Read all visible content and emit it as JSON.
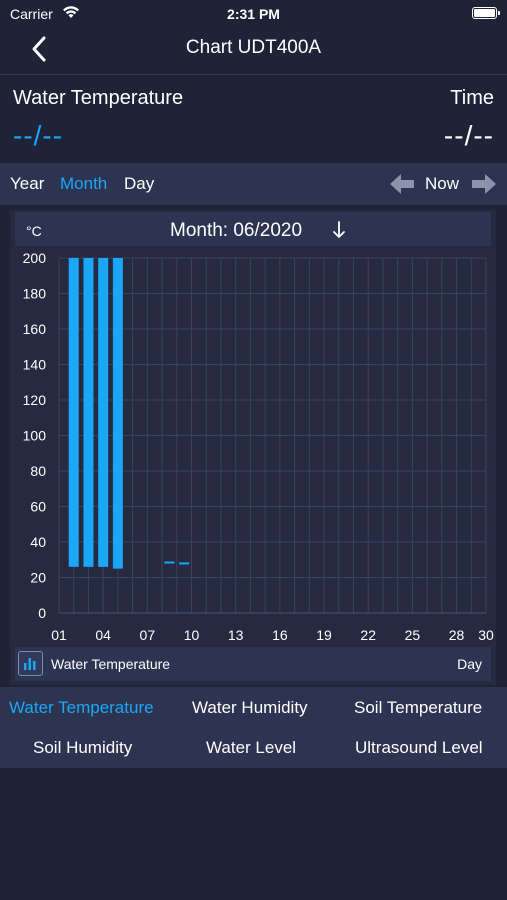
{
  "status_bar": {
    "carrier": "Carrier",
    "time": "2:31 PM",
    "wifi_icon": "wifi-icon",
    "battery_icon": "battery-icon"
  },
  "nav": {
    "title": "Chart UDT400A",
    "back_icon": "chevron-left-icon"
  },
  "readout": {
    "left_label": "Water Temperature",
    "left_value": "--/--",
    "right_label": "Time",
    "right_value": "--/--"
  },
  "period": {
    "tabs": [
      {
        "label": "Year",
        "active": false
      },
      {
        "label": "Month",
        "active": true
      },
      {
        "label": "Day",
        "active": false
      }
    ],
    "now_label": "Now"
  },
  "chart_header": {
    "unit": "°C",
    "month": "Month: 06/2020"
  },
  "chart_data": {
    "type": "bar",
    "ylim": [
      0,
      200
    ],
    "yticks": [
      0,
      20,
      40,
      60,
      80,
      100,
      120,
      140,
      160,
      180,
      200
    ],
    "xlim": [
      1,
      30
    ],
    "xticks": [
      "01",
      "04",
      "07",
      "10",
      "13",
      "16",
      "19",
      "22",
      "25",
      "28",
      "30"
    ],
    "xtick_values": [
      1,
      4,
      7,
      10,
      13,
      16,
      19,
      22,
      25,
      28,
      30
    ],
    "bars": [
      {
        "day": 2,
        "low": 26,
        "high": 200
      },
      {
        "day": 3,
        "low": 26,
        "high": 200
      },
      {
        "day": 4,
        "low": 26,
        "high": 200
      },
      {
        "day": 5,
        "low": 25,
        "high": 200
      },
      {
        "day": 8.5,
        "low": 28,
        "high": 29
      },
      {
        "day": 9.5,
        "low": 28,
        "high": 28.5
      }
    ],
    "grid": true,
    "bar_color": "#1aa7f5"
  },
  "legend": {
    "label": "Water Temperature",
    "right": "Day",
    "icon": "bar-chart-icon"
  },
  "sensors": [
    {
      "label": "Water Temperature",
      "active": true
    },
    {
      "label": "Water Humidity",
      "active": false
    },
    {
      "label": "Soil Temperature",
      "active": false
    },
    {
      "label": "Soil Humidity",
      "active": false
    },
    {
      "label": "Water Level",
      "active": false
    },
    {
      "label": "Ultrasound Level",
      "active": false
    }
  ],
  "colors": {
    "accent": "#1aa7f5",
    "background": "#1f2337",
    "panel": "#2d3451"
  }
}
